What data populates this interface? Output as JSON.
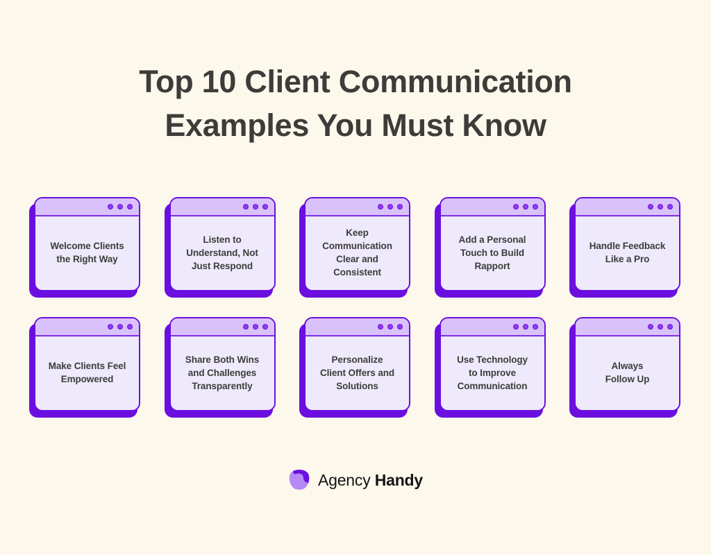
{
  "background_color": "#fdf8ec",
  "accent_colors": {
    "deep_purple": "#6b0fe0",
    "titlebar_purple": "#d9c2fb",
    "card_body": "#eeeafc",
    "dot_purple": "#8f3ef0",
    "text_dark": "#3d3c3a",
    "logo_dark": "#141414"
  },
  "heading": {
    "line1": "Top 10 Client Communication",
    "line2": "Examples You Must Know",
    "full": "Top 10 Client Communication Examples You Must Know"
  },
  "cards": [
    {
      "index": 1,
      "label": "Welcome Clients\nthe Right Way"
    },
    {
      "index": 2,
      "label": "Listen to\nUnderstand, Not\nJust Respond"
    },
    {
      "index": 3,
      "label": "Keep\nCommunication\nClear and\nConsistent"
    },
    {
      "index": 4,
      "label": "Add a Personal\nTouch to Build\nRapport"
    },
    {
      "index": 5,
      "label": "Handle Feedback\nLike a Pro"
    },
    {
      "index": 6,
      "label": "Make Clients Feel\nEmpowered"
    },
    {
      "index": 7,
      "label": "Share Both Wins\nand Challenges\nTransparently"
    },
    {
      "index": 8,
      "label": "Personalize\nClient Offers and\nSolutions"
    },
    {
      "index": 9,
      "label": "Use Technology\nto Improve\nCommunication"
    },
    {
      "index": 10,
      "label": "Always\nFollow Up"
    }
  ],
  "card_chrome": {
    "window_dots_count": 3,
    "dot_icon_name": "window-dot-icon"
  },
  "footer": {
    "logo_mark_name": "agency-handy-logo-mark",
    "brand_light": "Agency",
    "brand_bold": "Handy",
    "brand_full": "Agency Handy"
  }
}
